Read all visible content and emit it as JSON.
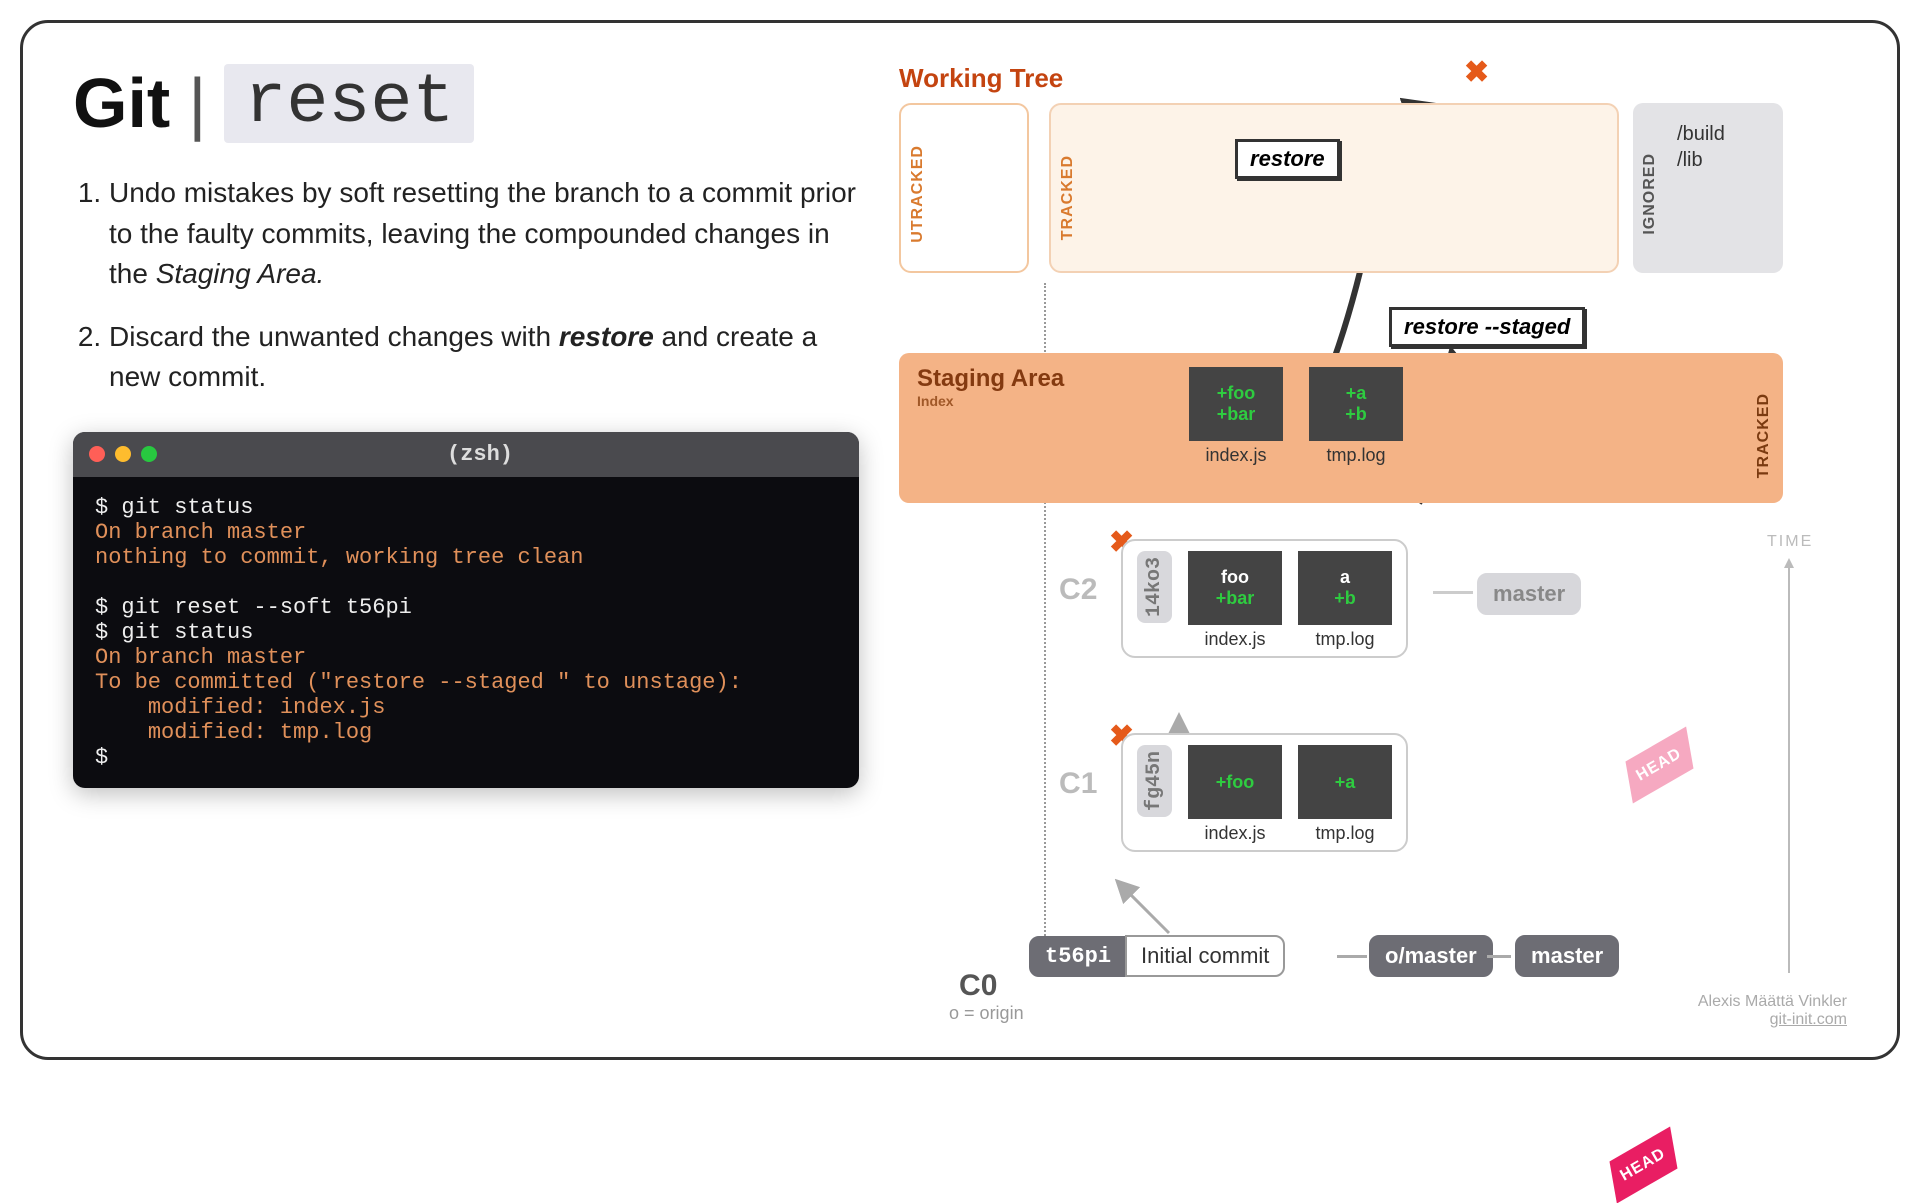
{
  "title": {
    "brand": "Git",
    "pipe": "|",
    "command": "reset"
  },
  "steps": [
    {
      "pre": "Undo mistakes by soft resetting the branch to a commit prior to the faulty commits, leaving the compounded changes in the ",
      "em": "Staging Area.",
      "post": ""
    },
    {
      "pre": "Discard the unwanted changes with ",
      "strong": "restore",
      "post": " and create a new commit."
    }
  ],
  "terminal": {
    "title": "(zsh)",
    "lines": [
      {
        "t": "cmd",
        "text": "git status"
      },
      {
        "t": "out",
        "text": "On branch master"
      },
      {
        "t": "out",
        "text": "nothing to commit, working tree clean"
      },
      {
        "t": "gap"
      },
      {
        "t": "cmd",
        "text": "git reset --soft t56pi"
      },
      {
        "t": "cmd",
        "text": "git status"
      },
      {
        "t": "out",
        "text": "On branch master"
      },
      {
        "t": "out",
        "text": "To be committed (\"restore --staged <f>\" to unstage):"
      },
      {
        "t": "out",
        "text": "    modified: index.js"
      },
      {
        "t": "out",
        "text": "    modified: tmp.log"
      },
      {
        "t": "prompt"
      }
    ]
  },
  "diagram": {
    "working_tree": {
      "title": "Working Tree",
      "labels": {
        "untracked": "UTRACKED",
        "tracked": "TRACKED",
        "ignored": "IGNORED"
      },
      "ignored": [
        "/build",
        "/lib"
      ]
    },
    "cmds": {
      "restore": "restore",
      "restore_staged": "restore --staged"
    },
    "staging": {
      "title": "Staging Area",
      "subtitle": "Index",
      "tracked_label": "TRACKED",
      "files": [
        {
          "name": "index.js",
          "lines": [
            "+foo",
            "+bar"
          ],
          "green": [
            true,
            true
          ]
        },
        {
          "name": "tmp.log",
          "lines": [
            "+a",
            "+b"
          ],
          "green": [
            true,
            true
          ]
        }
      ]
    },
    "commits": [
      {
        "id": "C2",
        "hash": "14ko3",
        "deleted": true,
        "branch": "master",
        "head": true,
        "head_light": true,
        "files": [
          {
            "name": "index.js",
            "lines": [
              "foo",
              "+bar"
            ],
            "green": [
              false,
              true
            ]
          },
          {
            "name": "tmp.log",
            "lines": [
              "a",
              "+b"
            ],
            "green": [
              false,
              true
            ]
          }
        ]
      },
      {
        "id": "C1",
        "hash": "fg45n",
        "deleted": true,
        "files": [
          {
            "name": "index.js",
            "lines": [
              "+foo"
            ],
            "green": [
              true
            ]
          },
          {
            "name": "tmp.log",
            "lines": [
              "+a"
            ],
            "green": [
              true
            ]
          }
        ]
      },
      {
        "id": "C0",
        "hash": "t56pi",
        "message": "Initial commit",
        "branches": [
          "o/master",
          "master"
        ],
        "head": true
      }
    ],
    "time_label": "TIME",
    "origin_legend": "o = origin",
    "author": "Alexis Määttä Vinkler",
    "site": "git-init.com"
  }
}
